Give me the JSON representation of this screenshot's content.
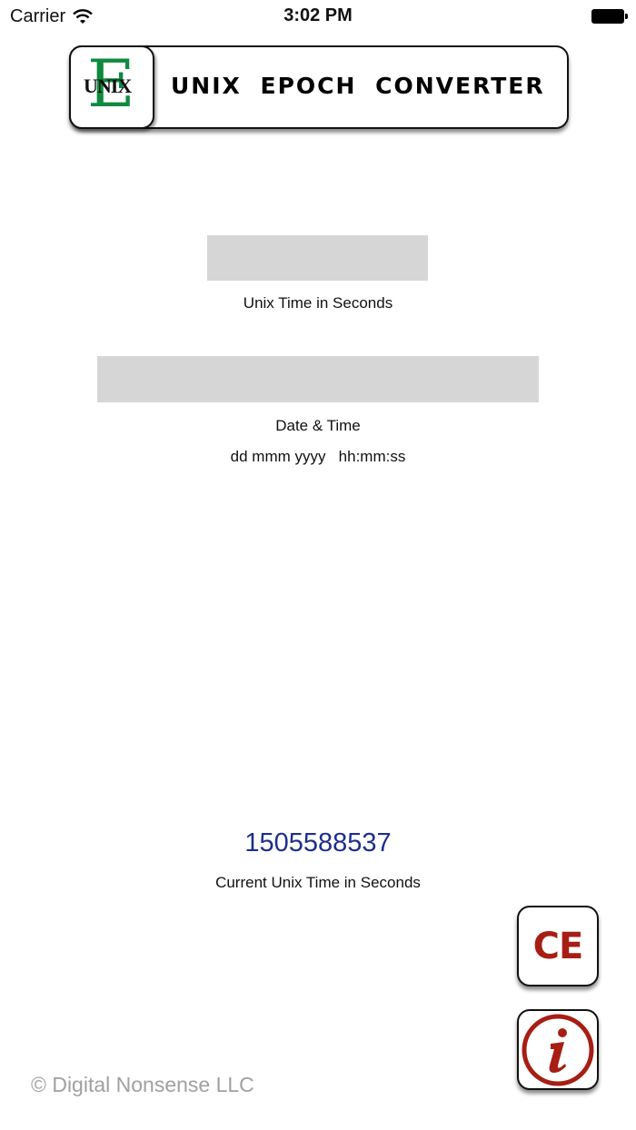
{
  "status_bar": {
    "carrier": "Carrier",
    "time": "3:02 PM"
  },
  "header": {
    "logo_letter": "E",
    "logo_word": "UNIX",
    "title": "UNIX EPOCH CONVERTER"
  },
  "converter": {
    "seconds_field": {
      "value": "",
      "placeholder": ""
    },
    "seconds_label": "Unix Time in Seconds",
    "date_field": {
      "value": "",
      "placeholder": ""
    },
    "date_label": "Date & Time",
    "date_format": "dd mmm yyyy   hh:mm:ss"
  },
  "current": {
    "value": "1505588537",
    "label": "Current Unix Time in Seconds"
  },
  "buttons": {
    "clear_label": "CE",
    "info_icon": "info-icon"
  },
  "footer": {
    "copyright": "© Digital Nonsense LLC"
  },
  "colors": {
    "accent_red": "#a61e14",
    "value_blue": "#1d2e8f",
    "logo_green": "#0f8a3f",
    "field_gray": "#d6d6d6"
  }
}
